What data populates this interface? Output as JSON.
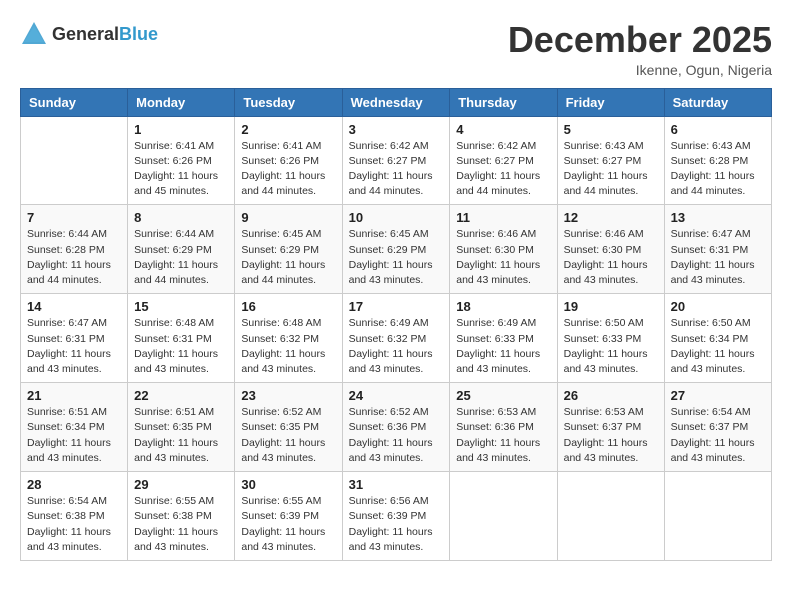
{
  "logo": {
    "general": "General",
    "blue": "Blue"
  },
  "title": "December 2025",
  "location": "Ikenne, Ogun, Nigeria",
  "weekdays": [
    "Sunday",
    "Monday",
    "Tuesday",
    "Wednesday",
    "Thursday",
    "Friday",
    "Saturday"
  ],
  "weeks": [
    [
      {
        "day": "",
        "sunrise": "",
        "sunset": "",
        "daylight": ""
      },
      {
        "day": "1",
        "sunrise": "Sunrise: 6:41 AM",
        "sunset": "Sunset: 6:26 PM",
        "daylight": "Daylight: 11 hours and 45 minutes."
      },
      {
        "day": "2",
        "sunrise": "Sunrise: 6:41 AM",
        "sunset": "Sunset: 6:26 PM",
        "daylight": "Daylight: 11 hours and 44 minutes."
      },
      {
        "day": "3",
        "sunrise": "Sunrise: 6:42 AM",
        "sunset": "Sunset: 6:27 PM",
        "daylight": "Daylight: 11 hours and 44 minutes."
      },
      {
        "day": "4",
        "sunrise": "Sunrise: 6:42 AM",
        "sunset": "Sunset: 6:27 PM",
        "daylight": "Daylight: 11 hours and 44 minutes."
      },
      {
        "day": "5",
        "sunrise": "Sunrise: 6:43 AM",
        "sunset": "Sunset: 6:27 PM",
        "daylight": "Daylight: 11 hours and 44 minutes."
      },
      {
        "day": "6",
        "sunrise": "Sunrise: 6:43 AM",
        "sunset": "Sunset: 6:28 PM",
        "daylight": "Daylight: 11 hours and 44 minutes."
      }
    ],
    [
      {
        "day": "7",
        "sunrise": "Sunrise: 6:44 AM",
        "sunset": "Sunset: 6:28 PM",
        "daylight": "Daylight: 11 hours and 44 minutes."
      },
      {
        "day": "8",
        "sunrise": "Sunrise: 6:44 AM",
        "sunset": "Sunset: 6:29 PM",
        "daylight": "Daylight: 11 hours and 44 minutes."
      },
      {
        "day": "9",
        "sunrise": "Sunrise: 6:45 AM",
        "sunset": "Sunset: 6:29 PM",
        "daylight": "Daylight: 11 hours and 44 minutes."
      },
      {
        "day": "10",
        "sunrise": "Sunrise: 6:45 AM",
        "sunset": "Sunset: 6:29 PM",
        "daylight": "Daylight: 11 hours and 43 minutes."
      },
      {
        "day": "11",
        "sunrise": "Sunrise: 6:46 AM",
        "sunset": "Sunset: 6:30 PM",
        "daylight": "Daylight: 11 hours and 43 minutes."
      },
      {
        "day": "12",
        "sunrise": "Sunrise: 6:46 AM",
        "sunset": "Sunset: 6:30 PM",
        "daylight": "Daylight: 11 hours and 43 minutes."
      },
      {
        "day": "13",
        "sunrise": "Sunrise: 6:47 AM",
        "sunset": "Sunset: 6:31 PM",
        "daylight": "Daylight: 11 hours and 43 minutes."
      }
    ],
    [
      {
        "day": "14",
        "sunrise": "Sunrise: 6:47 AM",
        "sunset": "Sunset: 6:31 PM",
        "daylight": "Daylight: 11 hours and 43 minutes."
      },
      {
        "day": "15",
        "sunrise": "Sunrise: 6:48 AM",
        "sunset": "Sunset: 6:31 PM",
        "daylight": "Daylight: 11 hours and 43 minutes."
      },
      {
        "day": "16",
        "sunrise": "Sunrise: 6:48 AM",
        "sunset": "Sunset: 6:32 PM",
        "daylight": "Daylight: 11 hours and 43 minutes."
      },
      {
        "day": "17",
        "sunrise": "Sunrise: 6:49 AM",
        "sunset": "Sunset: 6:32 PM",
        "daylight": "Daylight: 11 hours and 43 minutes."
      },
      {
        "day": "18",
        "sunrise": "Sunrise: 6:49 AM",
        "sunset": "Sunset: 6:33 PM",
        "daylight": "Daylight: 11 hours and 43 minutes."
      },
      {
        "day": "19",
        "sunrise": "Sunrise: 6:50 AM",
        "sunset": "Sunset: 6:33 PM",
        "daylight": "Daylight: 11 hours and 43 minutes."
      },
      {
        "day": "20",
        "sunrise": "Sunrise: 6:50 AM",
        "sunset": "Sunset: 6:34 PM",
        "daylight": "Daylight: 11 hours and 43 minutes."
      }
    ],
    [
      {
        "day": "21",
        "sunrise": "Sunrise: 6:51 AM",
        "sunset": "Sunset: 6:34 PM",
        "daylight": "Daylight: 11 hours and 43 minutes."
      },
      {
        "day": "22",
        "sunrise": "Sunrise: 6:51 AM",
        "sunset": "Sunset: 6:35 PM",
        "daylight": "Daylight: 11 hours and 43 minutes."
      },
      {
        "day": "23",
        "sunrise": "Sunrise: 6:52 AM",
        "sunset": "Sunset: 6:35 PM",
        "daylight": "Daylight: 11 hours and 43 minutes."
      },
      {
        "day": "24",
        "sunrise": "Sunrise: 6:52 AM",
        "sunset": "Sunset: 6:36 PM",
        "daylight": "Daylight: 11 hours and 43 minutes."
      },
      {
        "day": "25",
        "sunrise": "Sunrise: 6:53 AM",
        "sunset": "Sunset: 6:36 PM",
        "daylight": "Daylight: 11 hours and 43 minutes."
      },
      {
        "day": "26",
        "sunrise": "Sunrise: 6:53 AM",
        "sunset": "Sunset: 6:37 PM",
        "daylight": "Daylight: 11 hours and 43 minutes."
      },
      {
        "day": "27",
        "sunrise": "Sunrise: 6:54 AM",
        "sunset": "Sunset: 6:37 PM",
        "daylight": "Daylight: 11 hours and 43 minutes."
      }
    ],
    [
      {
        "day": "28",
        "sunrise": "Sunrise: 6:54 AM",
        "sunset": "Sunset: 6:38 PM",
        "daylight": "Daylight: 11 hours and 43 minutes."
      },
      {
        "day": "29",
        "sunrise": "Sunrise: 6:55 AM",
        "sunset": "Sunset: 6:38 PM",
        "daylight": "Daylight: 11 hours and 43 minutes."
      },
      {
        "day": "30",
        "sunrise": "Sunrise: 6:55 AM",
        "sunset": "Sunset: 6:39 PM",
        "daylight": "Daylight: 11 hours and 43 minutes."
      },
      {
        "day": "31",
        "sunrise": "Sunrise: 6:56 AM",
        "sunset": "Sunset: 6:39 PM",
        "daylight": "Daylight: 11 hours and 43 minutes."
      },
      {
        "day": "",
        "sunrise": "",
        "sunset": "",
        "daylight": ""
      },
      {
        "day": "",
        "sunrise": "",
        "sunset": "",
        "daylight": ""
      },
      {
        "day": "",
        "sunrise": "",
        "sunset": "",
        "daylight": ""
      }
    ]
  ]
}
